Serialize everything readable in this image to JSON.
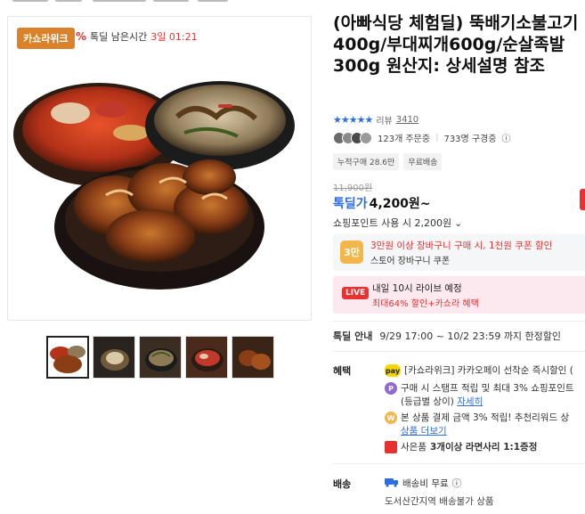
{
  "product": {
    "title": "(아빠식당 체험딜) 뚝배기소불고기400g/부대찌개600g/순살족발300g 원산지: 상세설명 참조",
    "badge": "카쇼라위크",
    "timer_icon": "%",
    "timer_label": "톡딜 남은시간",
    "timer_value": "3일 01:21"
  },
  "rating": {
    "stars": "★★★★★",
    "label": "리뷰",
    "count": "3410"
  },
  "social": {
    "orders": "123개 주문중",
    "subscribers": "733명 구경중",
    "separator": "|"
  },
  "chips": [
    "누적구매 28.6만",
    "무료배송"
  ],
  "price": {
    "original": "11,900원",
    "label": "톡딜가",
    "amount": "4,200원~"
  },
  "points": {
    "text": "쇼핑포인트 사용 시 2,200원",
    "chevron": "⌄"
  },
  "coupon": {
    "icon_text": "3만",
    "line1": "3만원 이상 장바구니 구매 시, 1천원 쿠폰 할인",
    "line2": "스토어 장바구니 쿠폰"
  },
  "live": {
    "tag": "LIVE",
    "line1": "내일 10시 라이브 예정",
    "line2": "최대64% 할인+카쇼라 혜택"
  },
  "deal": {
    "label": "톡딜 안내",
    "period": "9/29 17:00 ~ 10/2 23:59 까지 한정할인"
  },
  "benefits": {
    "label": "혜택",
    "items": [
      {
        "icon": "pay",
        "text": "[카쇼라위크] 카카오페이 선착순 즉시할인 ("
      },
      {
        "icon": "P",
        "text": "구매 시 스탬프 적립 및 최대 3% 쇼핑포인트",
        "sub": "(등급별 상이)",
        "link": "자세히"
      },
      {
        "icon": "W",
        "text": "본 상품 결제 금액 3% 적립! 추천리워드 상",
        "link": "상품 더보기"
      },
      {
        "icon": "gift",
        "text": "사은품",
        "bold": "3개이상 라면사리 1:1증정"
      }
    ]
  },
  "shipping": {
    "label": "배송",
    "fee": "배송비 무료",
    "info_icon": "ⓘ",
    "note": "도서산간지역 배송불가 상품"
  },
  "colors": {
    "accent_blue": "#2e6de0",
    "accent_red": "#e8322f",
    "badge_orange": "#d9822b"
  }
}
